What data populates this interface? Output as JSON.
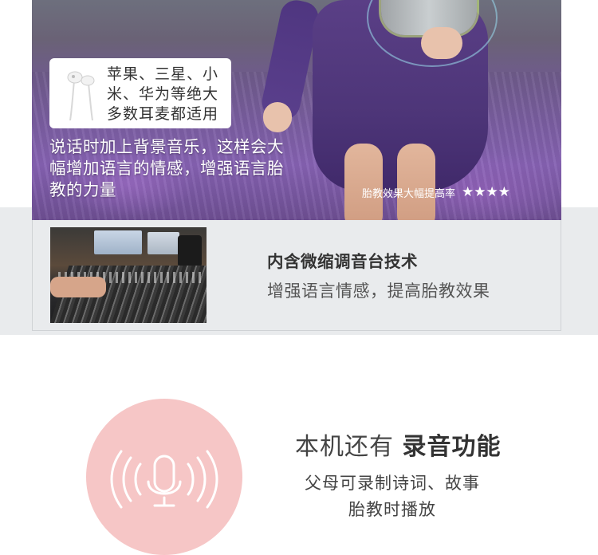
{
  "hero": {
    "earphone_caption": "苹果、三星、小米、华为等绝大多数耳麦都适用",
    "music_caption": "说话时加上背景音乐，这样会大幅增加语言的情感，增强语言胎教的力量",
    "rating_label": "胎教效果大幅提高率",
    "rating_stars": "★★★★",
    "rating_value": 4
  },
  "mixer": {
    "title": "内含微缩调音台技术",
    "subtitle": "增强语言情感，提高胎教效果"
  },
  "recording": {
    "title_prefix": "本机还有 ",
    "title_bold": "录音功能",
    "desc_line1": "父母可录制诗词、故事",
    "desc_line2": "胎教时播放",
    "icon": "microphone-icon"
  },
  "colors": {
    "circle_pink": "#f6c6c6",
    "panel_gray": "#e9ebed"
  }
}
